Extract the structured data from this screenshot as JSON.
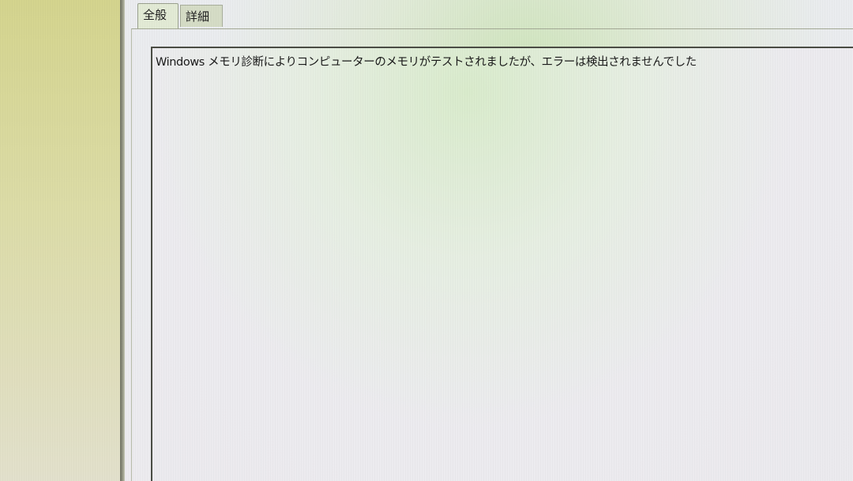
{
  "tabs": {
    "general": "全般",
    "details": "詳細"
  },
  "message": "Windows メモリ診断によりコンピューターのメモリがテストされましたが、エラーは検出されませんでした",
  "colors": {
    "text": "#1a1a1a",
    "panel_border": "#4a4c44"
  }
}
